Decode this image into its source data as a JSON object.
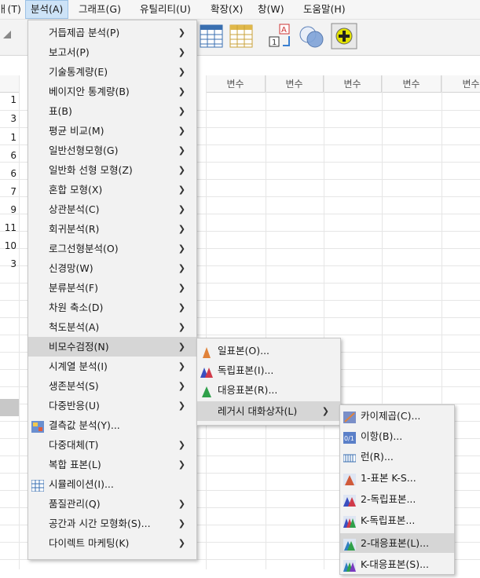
{
  "menubar": {
    "items": [
      {
        "label": "ㅐ(T)"
      },
      {
        "label": "분석(A)"
      },
      {
        "label": "그래프(G)"
      },
      {
        "label": "유틸리티(U)"
      },
      {
        "label": "확장(X)"
      },
      {
        "label": "창(W)"
      },
      {
        "label": "도움말(H)"
      }
    ]
  },
  "grid": {
    "column_header": "변수",
    "row_values": [
      "1",
      "3",
      "1",
      "6",
      "6",
      "7",
      "9",
      "11",
      "10",
      "3"
    ]
  },
  "analyze_menu": {
    "items": [
      {
        "label": "거듭제곱 분석(P)",
        "submenu": true
      },
      {
        "label": "보고서(P)",
        "submenu": true
      },
      {
        "label": "기술통계량(E)",
        "submenu": true
      },
      {
        "label": "베이지안 통계량(B)",
        "submenu": true
      },
      {
        "label": "표(B)",
        "submenu": true
      },
      {
        "label": "평균 비교(M)",
        "submenu": true
      },
      {
        "label": "일반선형모형(G)",
        "submenu": true
      },
      {
        "label": "일반화 선형 모형(Z)",
        "submenu": true
      },
      {
        "label": "혼합 모형(X)",
        "submenu": true
      },
      {
        "label": "상관분석(C)",
        "submenu": true
      },
      {
        "label": "회귀분석(R)",
        "submenu": true
      },
      {
        "label": "로그선형분석(O)",
        "submenu": true
      },
      {
        "label": "신경망(W)",
        "submenu": true
      },
      {
        "label": "분류분석(F)",
        "submenu": true
      },
      {
        "label": "차원 축소(D)",
        "submenu": true
      },
      {
        "label": "척도분석(A)",
        "submenu": true
      },
      {
        "label": "비모수검정(N)",
        "submenu": true
      },
      {
        "label": "시계열 분석(I)",
        "submenu": true
      },
      {
        "label": "생존분석(S)",
        "submenu": true
      },
      {
        "label": "다중반응(U)",
        "submenu": true
      },
      {
        "label": "결측값 분석(Y)...",
        "submenu": false,
        "icon": "missing-values-icon"
      },
      {
        "label": "다중대체(T)",
        "submenu": true
      },
      {
        "label": "복합 표본(L)",
        "submenu": true
      },
      {
        "label": "시뮬레이션(I)...",
        "submenu": false,
        "icon": "simulation-icon"
      },
      {
        "label": "품질관리(Q)",
        "submenu": true
      },
      {
        "label": "공간과 시간 모형화(S)...",
        "submenu": true
      },
      {
        "label": "다이렉트 마케팅(K)",
        "submenu": true
      }
    ]
  },
  "nonparam_menu": {
    "items": [
      {
        "label": "일표본(O)...",
        "icon": "one-sample-icon"
      },
      {
        "label": "독립표본(I)...",
        "icon": "independent-samples-icon"
      },
      {
        "label": "대응표본(R)...",
        "icon": "related-samples-icon"
      },
      {
        "label": "레거시 대화상자(L)",
        "submenu": true
      }
    ]
  },
  "legacy_menu": {
    "items": [
      {
        "label": "카이제곱(C)...",
        "icon": "chi-square-icon"
      },
      {
        "label": "이항(B)...",
        "icon": "binomial-icon"
      },
      {
        "label": "런(R)...",
        "icon": "runs-icon"
      },
      {
        "label": "1-표본 K-S...",
        "icon": "one-sample-ks-icon"
      },
      {
        "label": "2-독립표본...",
        "icon": "two-independent-samples-icon"
      },
      {
        "label": "K-독립표본...",
        "icon": "k-independent-samples-icon"
      },
      {
        "label": "2-대응표본(L)...",
        "icon": "two-related-samples-icon"
      },
      {
        "label": "K-대응표본(S)...",
        "icon": "k-related-samples-icon"
      }
    ]
  }
}
